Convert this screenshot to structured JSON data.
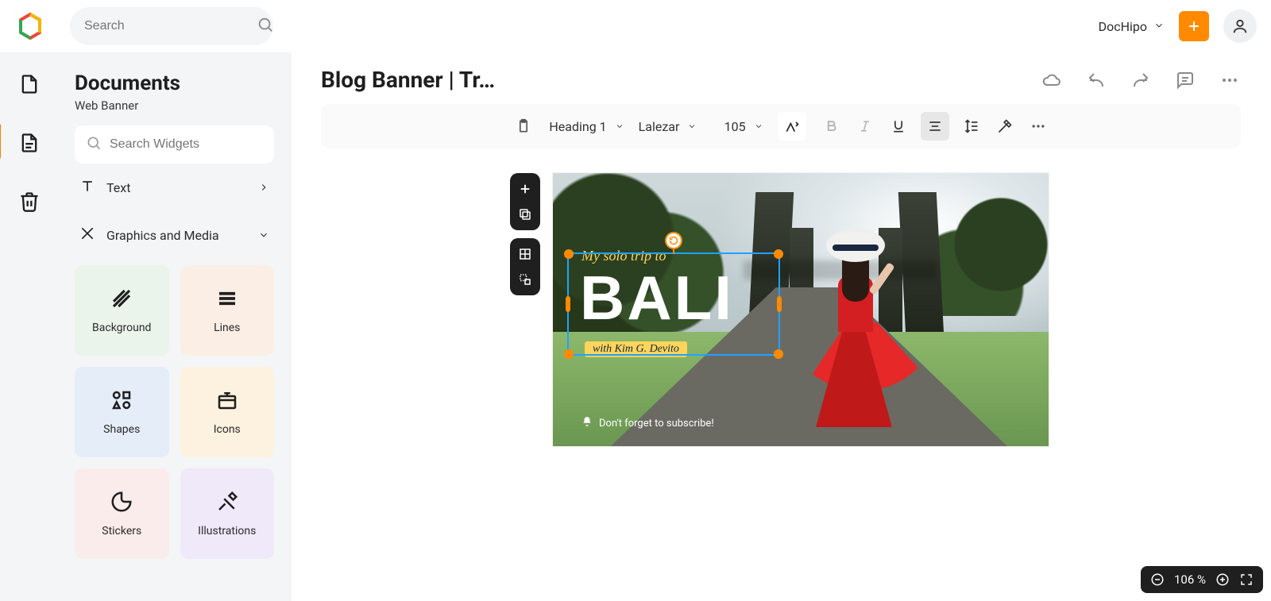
{
  "topbar": {
    "search_placeholder": "Search",
    "workspace": "DocHipo"
  },
  "panel": {
    "title": "Documents",
    "subtitle": "Web Banner",
    "widget_search_placeholder": "Search Widgets",
    "groups": {
      "text": "Text",
      "graphics": "Graphics and Media"
    },
    "tiles": {
      "background": "Background",
      "lines": "Lines",
      "shapes": "Shapes",
      "icons": "Icons",
      "stickers": "Stickers",
      "illustrations": "Illustrations"
    }
  },
  "doc": {
    "title": "Blog Banner | Tr…"
  },
  "toolbar": {
    "heading": "Heading 1",
    "font": "Lalezar",
    "size": "105"
  },
  "canvas": {
    "overline": "My solo trip to",
    "headline": "BALI",
    "byline": "with Kim G. Devito",
    "subscribe": "Don't forget to subscribe!"
  },
  "zoom": {
    "value": "106 %"
  }
}
